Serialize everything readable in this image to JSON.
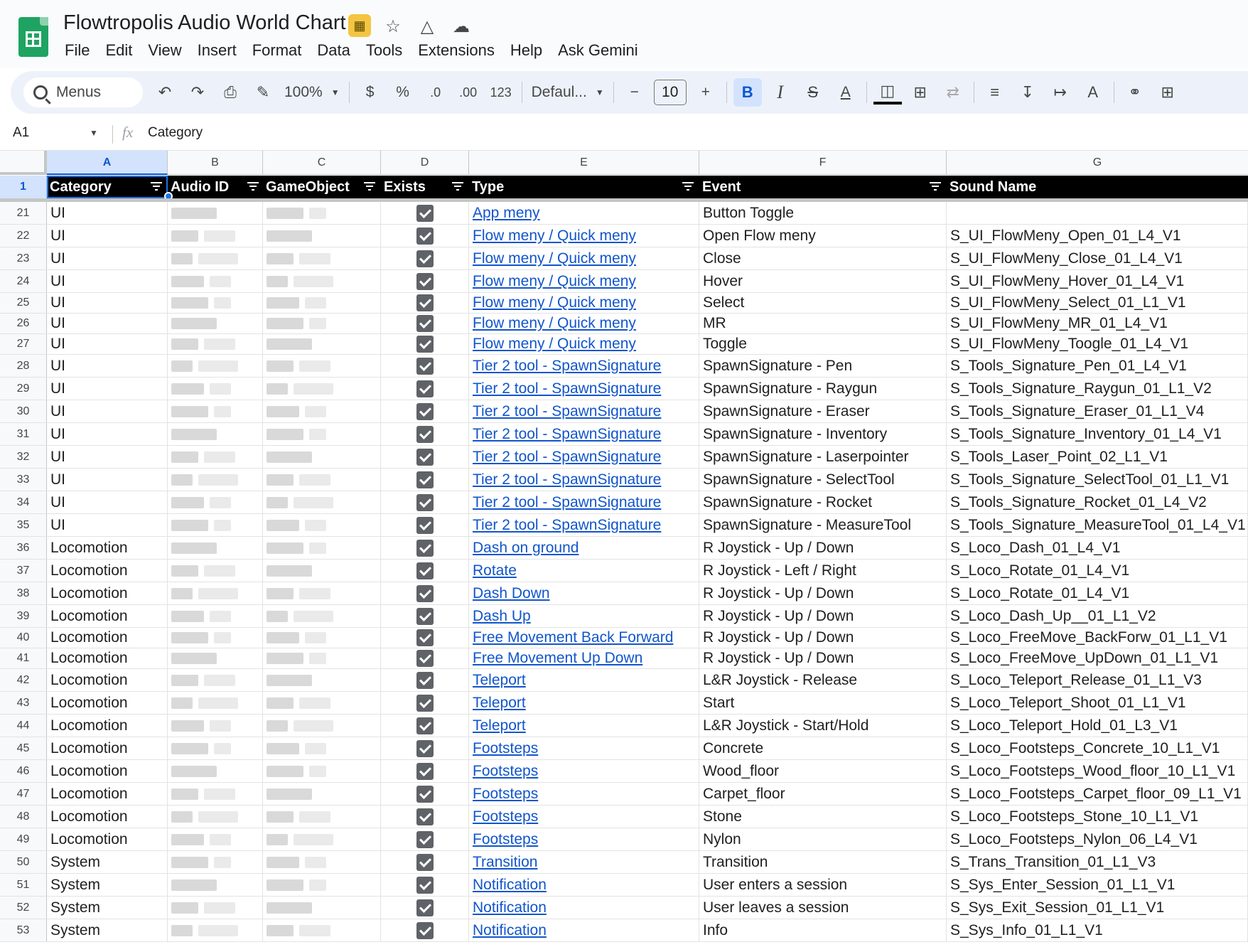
{
  "app": {
    "doc_title": "Flowtropolis Audio World Chart",
    "title_icons": [
      "no-access-icon",
      "star-icon",
      "move-to-drive-icon",
      "cloud-saved-icon"
    ],
    "menu": [
      "File",
      "Edit",
      "View",
      "Insert",
      "Format",
      "Data",
      "Tools",
      "Extensions",
      "Help",
      "Ask Gemini"
    ]
  },
  "toolbar": {
    "search_label": "Menus",
    "zoom": "100%",
    "currency": "$",
    "percent": "%",
    "decrease_decimals": ".0",
    "increase_decimals": ".00",
    "more_formats": "123",
    "font": "Defaul...",
    "font_size": "10",
    "minus": "−",
    "plus": "+",
    "bold": "B",
    "italic": "I",
    "text_color": "A"
  },
  "formula_bar": {
    "cell_ref": "A1",
    "fx": "fx",
    "value": "Category"
  },
  "columns": [
    "A",
    "B",
    "C",
    "D",
    "E",
    "F",
    "G"
  ],
  "header_row": {
    "row_number": "1",
    "labels": [
      "Category",
      "Audio ID",
      "GameObject",
      "Exists",
      "Type",
      "Event",
      "Sound Name"
    ]
  },
  "rows": [
    {
      "n": "21",
      "category": "UI",
      "type": "App meny",
      "event": "Button Toggle",
      "sound": ""
    },
    {
      "n": "22",
      "category": "UI",
      "type": "Flow meny / Quick meny",
      "event": "Open Flow meny",
      "sound": "S_UI_FlowMeny_Open_01_L4_V1"
    },
    {
      "n": "23",
      "category": "UI",
      "type": "Flow meny / Quick meny",
      "event": "Close",
      "sound": "S_UI_FlowMeny_Close_01_L4_V1"
    },
    {
      "n": "24",
      "category": "UI",
      "type": "Flow meny / Quick meny",
      "event": "Hover",
      "sound": "S_UI_FlowMeny_Hover_01_L4_V1"
    },
    {
      "n": "25",
      "category": "UI",
      "type": "Flow meny / Quick meny",
      "event": "Select",
      "sound": "S_UI_FlowMeny_Select_01_L1_V1"
    },
    {
      "n": "26",
      "category": "UI",
      "type": "Flow meny / Quick meny",
      "event": "MR",
      "sound": "S_UI_FlowMeny_MR_01_L4_V1"
    },
    {
      "n": "27",
      "category": "UI",
      "type": "Flow meny / Quick meny",
      "event": "Toggle",
      "sound": "S_UI_FlowMeny_Toogle_01_L4_V1"
    },
    {
      "n": "28",
      "category": "UI",
      "type": "Tier 2 tool - SpawnSignature",
      "event": "SpawnSignature - Pen",
      "sound": "S_Tools_Signature_Pen_01_L4_V1"
    },
    {
      "n": "29",
      "category": "UI",
      "type": "Tier 2 tool - SpawnSignature",
      "event": "SpawnSignature - Raygun",
      "sound": "S_Tools_Signature_Raygun_01_L1_V2"
    },
    {
      "n": "30",
      "category": "UI",
      "type": "Tier 2 tool - SpawnSignature",
      "event": "SpawnSignature - Eraser",
      "sound": "S_Tools_Signature_Eraser_01_L1_V4"
    },
    {
      "n": "31",
      "category": "UI",
      "type": "Tier 2 tool - SpawnSignature",
      "event": "SpawnSignature - Inventory",
      "sound": "S_Tools_Signature_Inventory_01_L4_V1"
    },
    {
      "n": "32",
      "category": "UI",
      "type": "Tier 2 tool - SpawnSignature",
      "event": "SpawnSignature - Laserpointer",
      "sound": "S_Tools_Laser_Point_02_L1_V1"
    },
    {
      "n": "33",
      "category": "UI",
      "type": "Tier 2 tool - SpawnSignature",
      "event": "SpawnSignature - SelectTool",
      "sound": "S_Tools_Signature_SelectTool_01_L1_V1"
    },
    {
      "n": "34",
      "category": "UI",
      "type": "Tier 2 tool - SpawnSignature",
      "event": "SpawnSignature - Rocket",
      "sound": "S_Tools_Signature_Rocket_01_L4_V2"
    },
    {
      "n": "35",
      "category": "UI",
      "type": "Tier 2 tool - SpawnSignature",
      "event": "SpawnSignature - MeasureTool",
      "sound": "S_Tools_Signature_MeasureTool_01_L4_V1"
    },
    {
      "n": "36",
      "category": "Locomotion",
      "type": "Dash on ground",
      "event": "R Joystick - Up / Down",
      "sound": "S_Loco_Dash_01_L4_V1"
    },
    {
      "n": "37",
      "category": "Locomotion",
      "type": "Rotate",
      "event": "R Joystick - Left / Right",
      "sound": "S_Loco_Rotate_01_L4_V1"
    },
    {
      "n": "38",
      "category": "Locomotion",
      "type": "Dash Down",
      "event": "R Joystick - Up / Down",
      "sound": "S_Loco_Rotate_01_L4_V1"
    },
    {
      "n": "39",
      "category": "Locomotion",
      "type": "Dash Up",
      "event": "R Joystick - Up / Down",
      "sound": "S_Loco_Dash_Up__01_L1_V2"
    },
    {
      "n": "40",
      "category": "Locomotion",
      "type": "Free Movement Back Forward",
      "event": "R Joystick - Up / Down",
      "sound": "S_Loco_FreeMove_BackForw_01_L1_V1"
    },
    {
      "n": "41",
      "category": "Locomotion",
      "type": "Free Movement Up Down",
      "event": "R Joystick - Up / Down",
      "sound": "S_Loco_FreeMove_UpDown_01_L1_V1"
    },
    {
      "n": "42",
      "category": "Locomotion",
      "type": "Teleport",
      "event": "L&R Joystick - Release",
      "sound": "S_Loco_Teleport_Release_01_L1_V3"
    },
    {
      "n": "43",
      "category": "Locomotion",
      "type": "Teleport",
      "event": "Start",
      "sound": "S_Loco_Teleport_Shoot_01_L1_V1"
    },
    {
      "n": "44",
      "category": "Locomotion",
      "type": "Teleport",
      "event": "L&R Joystick - Start/Hold",
      "sound": "S_Loco_Teleport_Hold_01_L3_V1"
    },
    {
      "n": "45",
      "category": "Locomotion",
      "type": "Footsteps",
      "event": "Concrete",
      "sound": "S_Loco_Footsteps_Concrete_10_L1_V1"
    },
    {
      "n": "46",
      "category": "Locomotion",
      "type": "Footsteps",
      "event": "Wood_floor",
      "sound": "S_Loco_Footsteps_Wood_floor_10_L1_V1"
    },
    {
      "n": "47",
      "category": "Locomotion",
      "type": "Footsteps",
      "event": "Carpet_floor",
      "sound": "S_Loco_Footsteps_Carpet_floor_09_L1_V1"
    },
    {
      "n": "48",
      "category": "Locomotion",
      "type": "Footsteps",
      "event": "Stone",
      "sound": "S_Loco_Footsteps_Stone_10_L1_V1"
    },
    {
      "n": "49",
      "category": "Locomotion",
      "type": "Footsteps",
      "event": "Nylon",
      "sound": "S_Loco_Footsteps_Nylon_06_L4_V1"
    },
    {
      "n": "50",
      "category": "System",
      "type": "Transition",
      "event": "Transition",
      "sound": "S_Trans_Transition_01_L1_V3"
    },
    {
      "n": "51",
      "category": "System",
      "type": "Notification",
      "event": "User enters a session",
      "sound": "S_Sys_Enter_Session_01_L1_V1"
    },
    {
      "n": "52",
      "category": "System",
      "type": "Notification",
      "event": "User leaves a session",
      "sound": "S_Sys_Exit_Session_01_L1_V1"
    },
    {
      "n": "53",
      "category": "System",
      "type": "Notification",
      "event": "Info",
      "sound": "S_Sys_Info_01_L1_V1"
    }
  ],
  "colors": {
    "header_bg": "#000000",
    "link": "#1155cc",
    "selection": "#1a73e8",
    "toolbar_bg": "#edf2fa",
    "brand": "#1ea362"
  }
}
